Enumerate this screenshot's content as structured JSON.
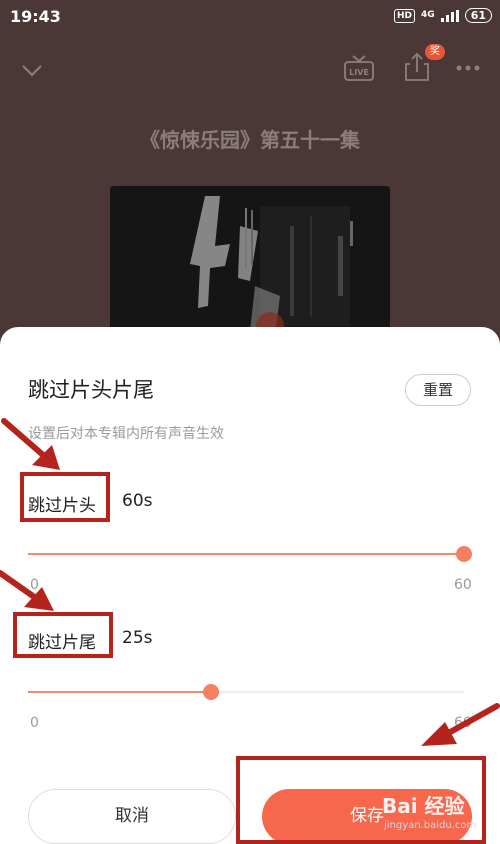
{
  "status_bar": {
    "time": "19:43",
    "hd": "HD",
    "network": "4G",
    "battery": "61"
  },
  "header": {
    "share_badge": "奖"
  },
  "episode": {
    "title": "《惊悚乐园》第五十一集"
  },
  "sheet": {
    "title": "跳过片头片尾",
    "reset_label": "重置",
    "subtitle": "设置后对本专辑内所有声音生效",
    "intro": {
      "label": "跳过片头",
      "value": "60s",
      "min": "0",
      "max": "60",
      "fraction": 1.0
    },
    "outro": {
      "label": "跳过片尾",
      "value": "25s",
      "min": "0",
      "max": "60",
      "fraction": 0.42
    },
    "cancel_label": "取消",
    "save_label": "保存"
  },
  "watermark": {
    "brand": "Bai 经验",
    "url": "jingyan.baidu.com"
  },
  "colors": {
    "accent": "#f6674b",
    "annotation": "#b4231c",
    "backdrop": "#4b3836"
  }
}
